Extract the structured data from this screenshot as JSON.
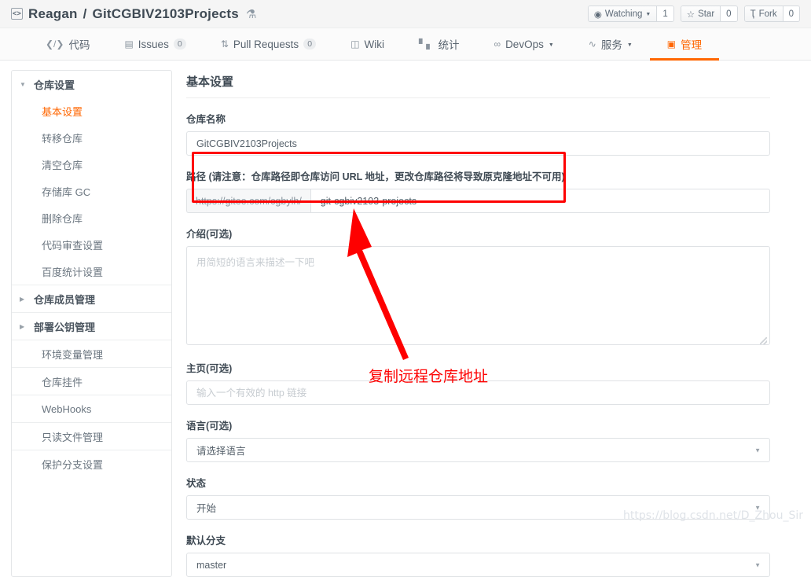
{
  "header": {
    "owner": "Reagan",
    "separator": "/",
    "repo": "GitCGBIV2103Projects",
    "code_icon": "code-icon",
    "award_icon": "award-badge-icon",
    "actions": [
      {
        "icon": "eye-icon",
        "label": "Watching",
        "has_caret": true,
        "count": "1"
      },
      {
        "icon": "star-icon",
        "label": "Star",
        "has_caret": false,
        "count": "0"
      },
      {
        "icon": "fork-icon",
        "label": "Fork",
        "has_caret": false,
        "count": "0"
      }
    ]
  },
  "nav": [
    {
      "icon": "code-icon",
      "label": "代码",
      "badge": null,
      "caret": false,
      "active": false
    },
    {
      "icon": "issues-icon",
      "label": "Issues",
      "badge": "0",
      "caret": false,
      "active": false
    },
    {
      "icon": "pull-request-icon",
      "label": "Pull Requests",
      "badge": "0",
      "caret": false,
      "active": false
    },
    {
      "icon": "wiki-icon",
      "label": "Wiki",
      "badge": null,
      "caret": false,
      "active": false
    },
    {
      "icon": "chart-icon",
      "label": "统计",
      "badge": null,
      "caret": false,
      "active": false
    },
    {
      "icon": "devops-icon",
      "label": "DevOps",
      "badge": null,
      "caret": true,
      "active": false
    },
    {
      "icon": "service-icon",
      "label": "服务",
      "badge": null,
      "caret": true,
      "active": false
    },
    {
      "icon": "manage-icon",
      "label": "管理",
      "badge": null,
      "caret": false,
      "active": true
    }
  ],
  "sidebar": {
    "groups": [
      {
        "items": [
          {
            "label": "仓库设置",
            "type": "head",
            "expanded": true,
            "active": false
          },
          {
            "label": "基本设置",
            "type": "sub",
            "active": true
          },
          {
            "label": "转移仓库",
            "type": "sub",
            "active": false
          },
          {
            "label": "清空仓库",
            "type": "sub",
            "active": false
          },
          {
            "label": "存储库 GC",
            "type": "sub",
            "active": false
          },
          {
            "label": "删除仓库",
            "type": "sub",
            "active": false
          },
          {
            "label": "代码审查设置",
            "type": "sub",
            "active": false
          },
          {
            "label": "百度统计设置",
            "type": "sub",
            "active": false
          }
        ]
      }
    ],
    "standalone": [
      {
        "label": "仓库成员管理",
        "type": "head",
        "expanded": false
      },
      {
        "label": "部署公钥管理",
        "type": "head",
        "expanded": false
      },
      {
        "label": "环境变量管理",
        "type": "plain"
      },
      {
        "label": "仓库挂件",
        "type": "plain"
      },
      {
        "label": "WebHooks",
        "type": "plain"
      },
      {
        "label": "只读文件管理",
        "type": "plain"
      },
      {
        "label": "保护分支设置",
        "type": "plain"
      }
    ]
  },
  "main": {
    "title": "基本设置",
    "repo_name": {
      "label": "仓库名称",
      "value": "GitCGBIV2103Projects"
    },
    "path": {
      "label": "路径 (请注意：仓库路径即仓库访问 URL 地址，更改仓库路径将导致原克隆地址不可用)",
      "prefix": "https://gitee.com/cgbylh/",
      "value": "git-cgbiv2103-projects"
    },
    "description": {
      "label": "介绍(可选)",
      "value": "",
      "placeholder": "用简短的语言来描述一下吧"
    },
    "homepage": {
      "label": "主页(可选)",
      "value": "",
      "placeholder": "输入一个有效的 http 链接"
    },
    "language": {
      "label": "语言(可选)",
      "value": "请选择语言"
    },
    "status": {
      "label": "状态",
      "value": "开始"
    },
    "default_branch": {
      "label": "默认分支",
      "value": "master"
    }
  },
  "annotations": {
    "text": "复制远程仓库地址",
    "color": "#fe0000",
    "highlight_target": "path-field"
  },
  "watermark": "https://blog.csdn.net/D_Zhou_Sir",
  "colors": {
    "accent": "#ff6600",
    "annotation": "#fe0000",
    "text": "#3f4a54"
  }
}
